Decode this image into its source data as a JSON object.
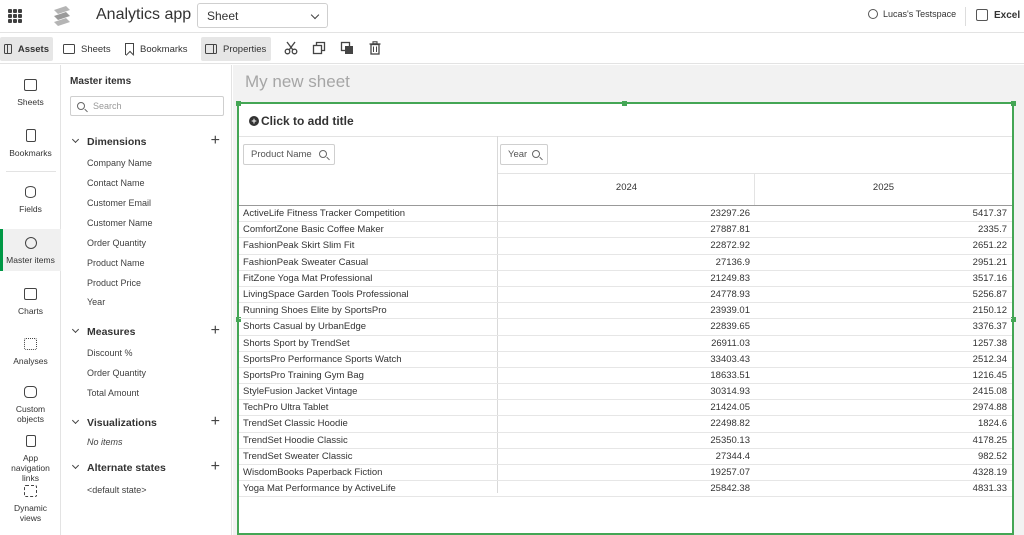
{
  "header": {
    "app_title": "Analytics app",
    "sheet_select": "Sheet",
    "space": "Lucas's Testspace",
    "export_label": "Excel"
  },
  "toolbar": {
    "assets": "Assets",
    "sheets": "Sheets",
    "bookmarks": "Bookmarks",
    "properties": "Properties"
  },
  "rail": [
    {
      "label": "Sheets",
      "icon": "sheets-icon"
    },
    {
      "label": "Bookmarks",
      "icon": "bookmark-icon"
    },
    {
      "label": "Fields",
      "icon": "database-icon"
    },
    {
      "label": "Master items",
      "icon": "link-icon"
    },
    {
      "label": "Charts",
      "icon": "chart-icon"
    },
    {
      "label": "Analyses",
      "icon": "analyses-icon"
    },
    {
      "label": "Custom objects",
      "icon": "puzzle-icon"
    },
    {
      "label": "App navigation links",
      "icon": "navigation-icon"
    },
    {
      "label": "Dynamic views",
      "icon": "dynamic-icon"
    }
  ],
  "panel": {
    "title": "Master items",
    "search_placeholder": "Search",
    "dimensions": {
      "label": "Dimensions",
      "items": [
        "Company Name",
        "Contact Name",
        "Customer Email",
        "Customer Name",
        "Order Quantity",
        "Product Name",
        "Product Price",
        "Year"
      ]
    },
    "measures": {
      "label": "Measures",
      "items": [
        "Discount %",
        "Order Quantity",
        "Total Amount"
      ]
    },
    "visualizations": {
      "label": "Visualizations",
      "empty": "No items"
    },
    "alternate_states": {
      "label": "Alternate states",
      "items": [
        "<default state>"
      ]
    }
  },
  "canvas": {
    "sheet_title": "My new sheet",
    "object_title": "Click to add title",
    "product_filter": "Product Name",
    "year_filter": "Year",
    "col_2024": "2024",
    "col_2025": "2025",
    "rows": [
      {
        "product": "ActiveLife Fitness Tracker Competition",
        "y2024": "23297.26",
        "y2025": "5417.37"
      },
      {
        "product": "ComfortZone Basic Coffee Maker",
        "y2024": "27887.81",
        "y2025": "2335.7"
      },
      {
        "product": "FashionPeak Skirt Slim Fit",
        "y2024": "22872.92",
        "y2025": "2651.22"
      },
      {
        "product": "FashionPeak Sweater Casual",
        "y2024": "27136.9",
        "y2025": "2951.21"
      },
      {
        "product": "FitZone Yoga Mat Professional",
        "y2024": "21249.83",
        "y2025": "3517.16"
      },
      {
        "product": "LivingSpace Garden Tools Professional",
        "y2024": "24778.93",
        "y2025": "5256.87"
      },
      {
        "product": "Running Shoes Elite by SportsPro",
        "y2024": "23939.01",
        "y2025": "2150.12"
      },
      {
        "product": "Shorts Casual by UrbanEdge",
        "y2024": "22839.65",
        "y2025": "3376.37"
      },
      {
        "product": "Shorts Sport by TrendSet",
        "y2024": "26911.03",
        "y2025": "1257.38"
      },
      {
        "product": "SportsPro Performance Sports Watch",
        "y2024": "33403.43",
        "y2025": "2512.34"
      },
      {
        "product": "SportsPro Training Gym Bag",
        "y2024": "18633.51",
        "y2025": "1216.45"
      },
      {
        "product": "StyleFusion Jacket Vintage",
        "y2024": "30314.93",
        "y2025": "2415.08"
      },
      {
        "product": "TechPro Ultra Tablet",
        "y2024": "21424.05",
        "y2025": "2974.88"
      },
      {
        "product": "TrendSet Classic Hoodie",
        "y2024": "22498.82",
        "y2025": "1824.6"
      },
      {
        "product": "TrendSet Hoodie Classic",
        "y2024": "25350.13",
        "y2025": "4178.25"
      },
      {
        "product": "TrendSet Sweater Classic",
        "y2024": "27344.4",
        "y2025": "982.52"
      },
      {
        "product": "WisdomBooks Paperback Fiction",
        "y2024": "19257.07",
        "y2025": "4328.19"
      },
      {
        "product": "Yoga Mat Performance by ActiveLife",
        "y2024": "25842.38",
        "y2025": "4831.33"
      }
    ]
  },
  "colors": {
    "accent_green": "#44a655",
    "rail_active": "#009845"
  }
}
